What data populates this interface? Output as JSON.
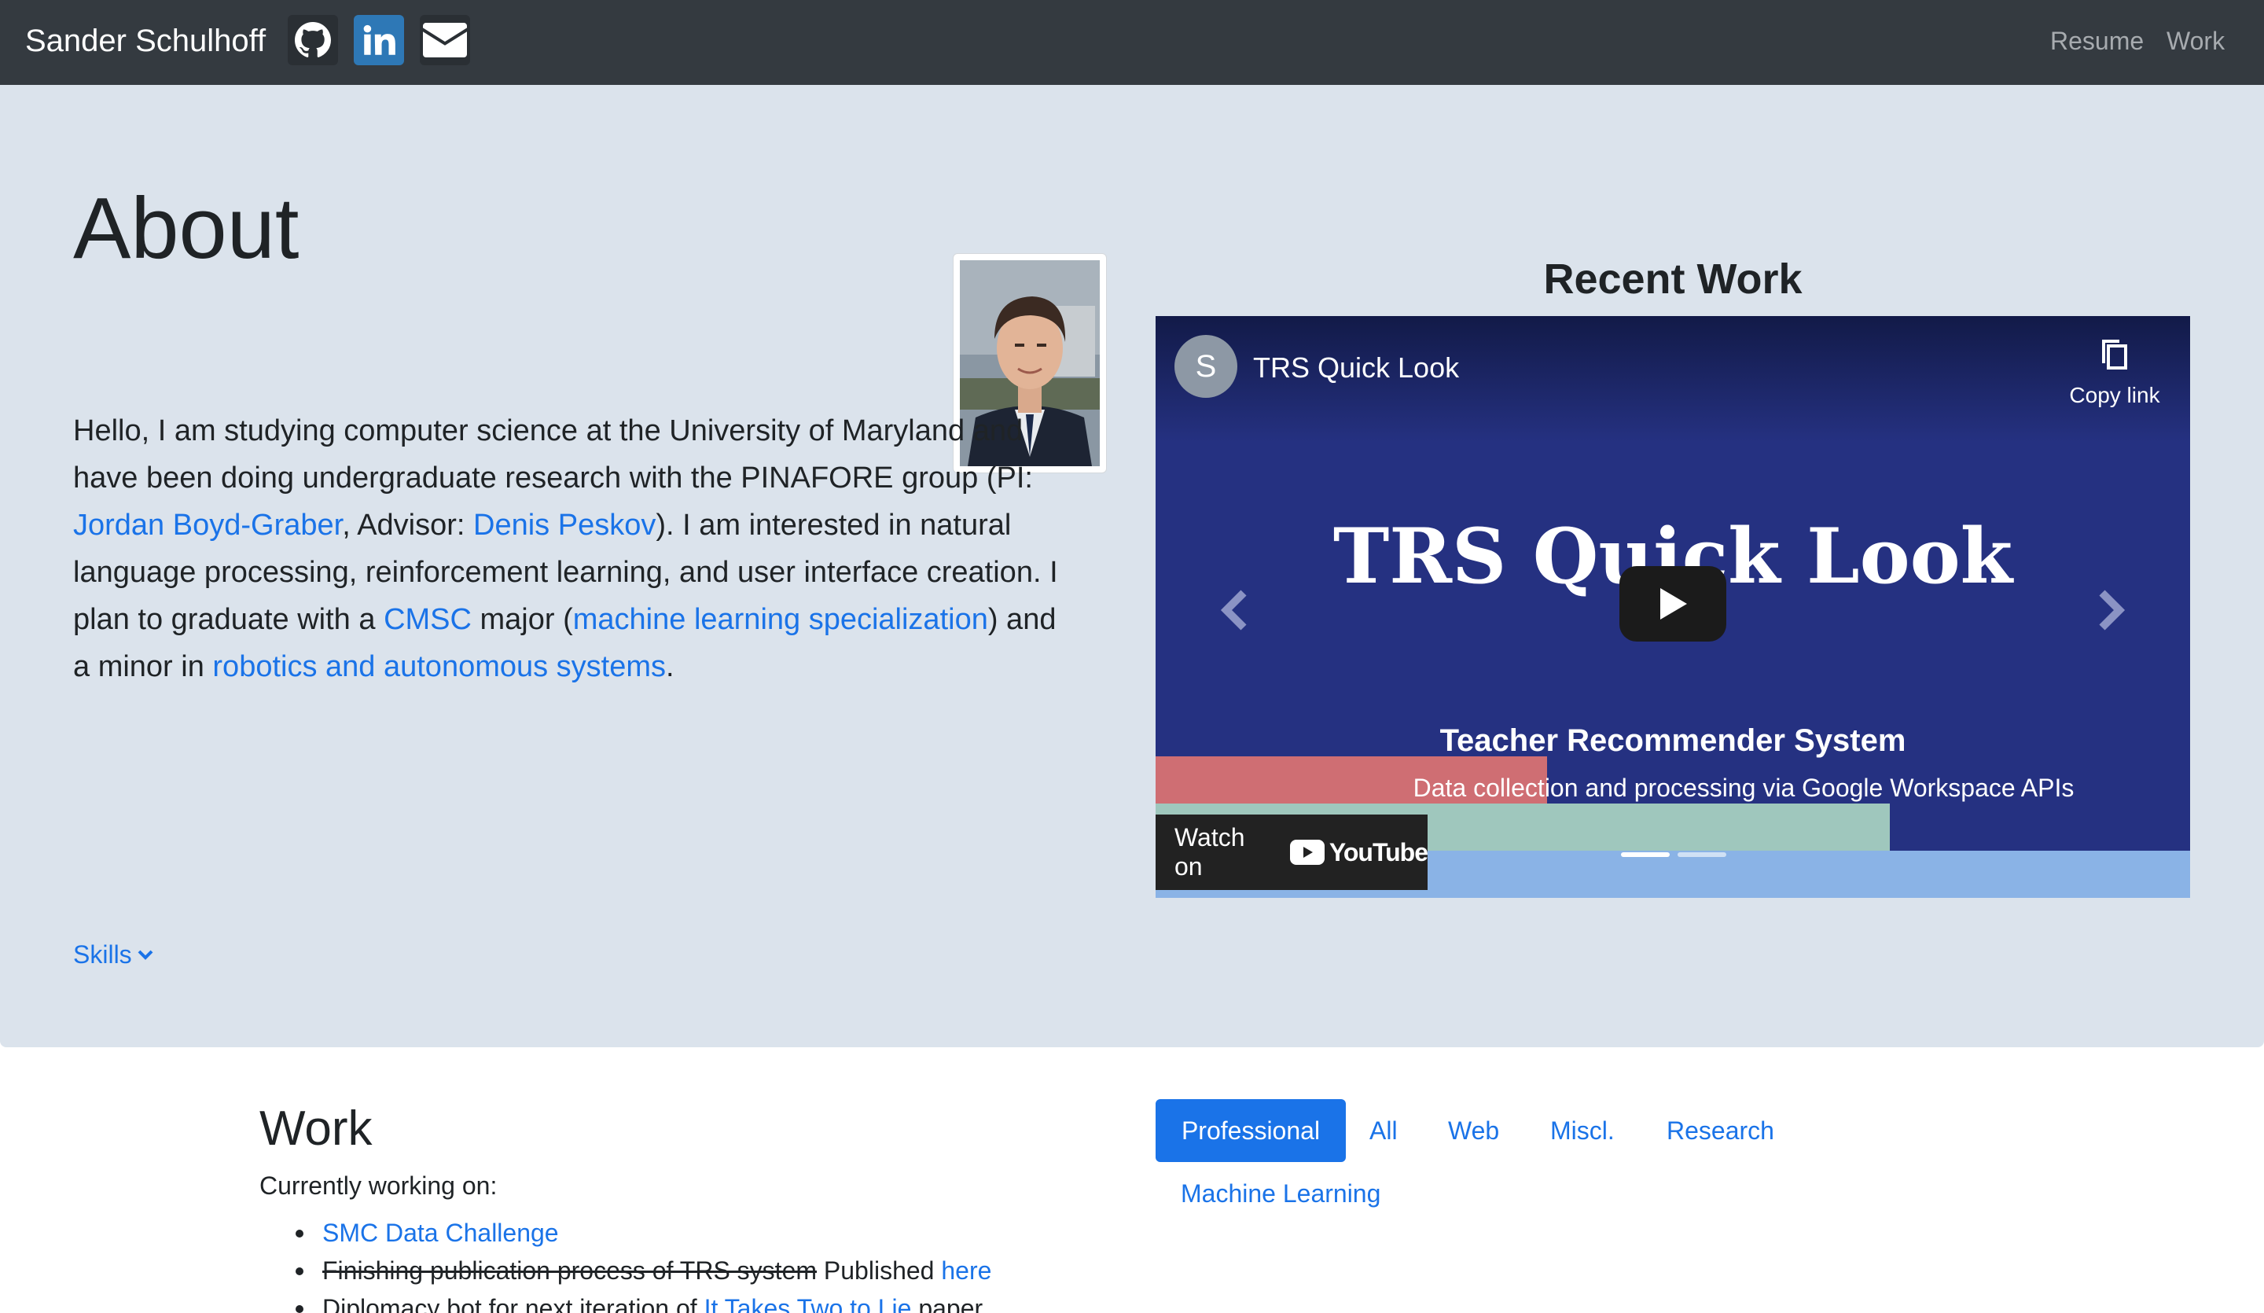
{
  "navbar": {
    "brand": "Sander Schulhoff",
    "links": {
      "resume": "Resume",
      "work": "Work"
    }
  },
  "about": {
    "title": "About",
    "paragraph": {
      "p1": "Hello, I am studying computer science at the University of Maryland and have been doing undergraduate research with the PINAFORE group (PI: ",
      "link_pi": "Jordan Boyd-Graber",
      "p2": ", Advisor: ",
      "link_advisor": "Denis Peskov",
      "p3": "). I am interested in natural language processing, reinforcement learning, and user interface creation. I plan to graduate with a ",
      "link_cmsc": "CMSC",
      "p4": " major (",
      "link_ml": "machine learning specialization",
      "p5": ") and a minor in ",
      "link_robotics": "robotics and autonomous systems",
      "p6": "."
    },
    "skills_toggle": "Skills"
  },
  "recent_work": {
    "title": "Recent Work",
    "video": {
      "channel_initial": "S",
      "video_title": "TRS Quick Look",
      "copy_link": "Copy link",
      "slide_title": "TRS Quick Look",
      "slide_subtitle": "Teacher Recommender System",
      "slide_caption": "Data collection and processing via Google Workspace APIs",
      "watch_on": "Watch on",
      "youtube": "YouTube"
    }
  },
  "work": {
    "title": "Work",
    "currently": "Currently working on:",
    "items": {
      "smc": "SMC Data Challenge",
      "trs_strike": "Finishing publication process of TRS system",
      "trs_published": " Published ",
      "trs_here": "here",
      "diplomacy_pre": "Diplomacy bot for next iteration of ",
      "diplomacy_link": "It Takes Two to Lie",
      "diplomacy_post": " paper"
    },
    "filters": {
      "professional": "Professional",
      "all": "All",
      "web": "Web",
      "misc": "Miscl.",
      "research": "Research",
      "ml": "Machine Learning"
    }
  },
  "icons": {
    "github": "github-icon",
    "linkedin": "linkedin-icon",
    "email": "envelope-icon",
    "chevron": "chevron-down-icon",
    "play": "play-icon",
    "copy": "copy-icon",
    "prev": "chevron-left-icon",
    "next": "chevron-right-icon"
  },
  "colors": {
    "navbar": "#343a40",
    "hero_bg": "#dbe3ec",
    "link": "#1a73e8",
    "linkedin": "#2e78b6",
    "video_bg": "#253181"
  }
}
